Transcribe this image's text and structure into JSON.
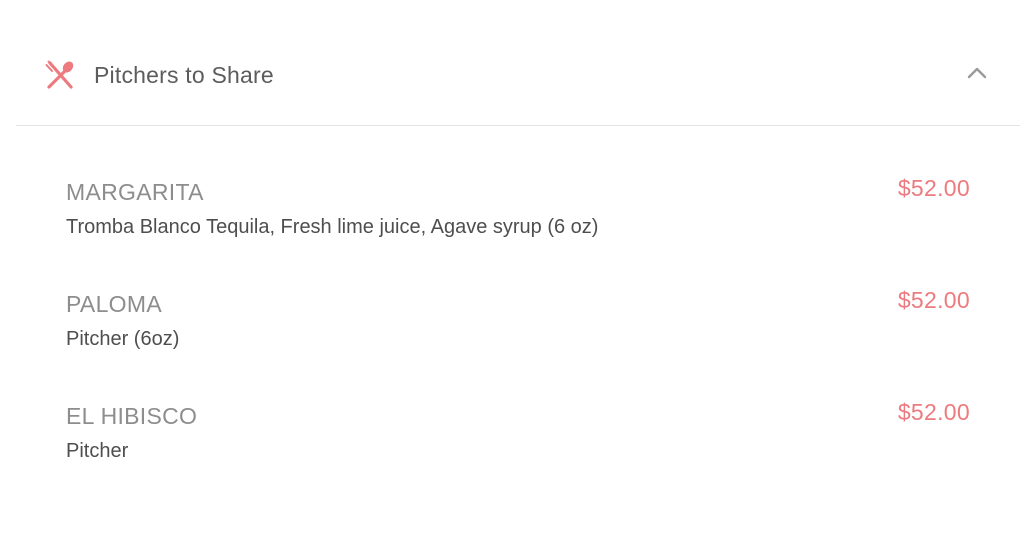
{
  "section": {
    "title": "Pitchers to Share",
    "icon": "utensils-icon",
    "toggle_icon": "chevron-up-icon",
    "accent_color": "#ec7a7e"
  },
  "items": [
    {
      "name": "MARGARITA",
      "description": "Tromba Blanco Tequila, Fresh lime juice, Agave syrup (6 oz)",
      "price": "$52.00"
    },
    {
      "name": "PALOMA",
      "description": "Pitcher (6oz)",
      "price": "$52.00"
    },
    {
      "name": "EL HIBISCO",
      "description": "Pitcher",
      "price": "$52.00"
    }
  ]
}
